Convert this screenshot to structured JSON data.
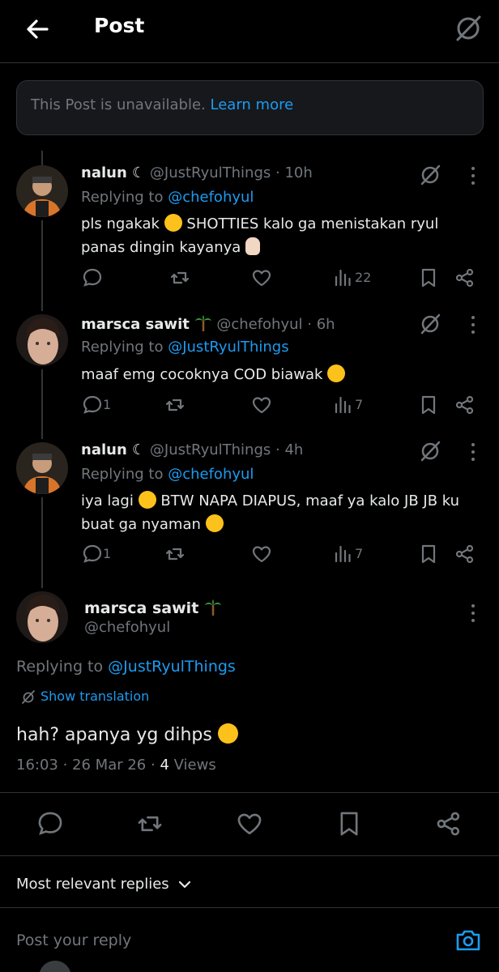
{
  "header": {
    "title": "Post",
    "back_icon": "arrow-left-icon",
    "grok_icon": "grok-icon"
  },
  "unavailable": {
    "text": "This Post is unavailable.",
    "link": "Learn more"
  },
  "replies": [
    {
      "name": "nalun ☾",
      "handle": "@JustRyulThings",
      "time": "· 10h",
      "replying_label": "Replying to",
      "replying_to": "@chefohyul",
      "text_a": "pls ngakak",
      "text_b": "SHOTTIES kalo ga menistakan ryul panas dingin kayanya",
      "replies": "",
      "views": "22"
    },
    {
      "name": "marsca sawit",
      "handle": "@chefohyul",
      "time": "· 6h",
      "replying_label": "Replying to",
      "replying_to": "@JustRyulThings",
      "text_a": "maaf emg cocoknya COD biawak",
      "replies": "1",
      "views": "7"
    },
    {
      "name": "nalun ☾",
      "handle": "@JustRyulThings",
      "time": "· 4h",
      "replying_label": "Replying to",
      "replying_to": "@chefohyul",
      "text_a": "iya lagi",
      "text_b": "BTW NAPA DIAPUS, maaf ya kalo JB JB ku buat ga nyaman",
      "replies": "1",
      "views": "7"
    }
  ],
  "main_post": {
    "name": "marsca sawit",
    "handle": "@chefohyul",
    "replying_label": "Replying to",
    "replying_to": "@JustRyulThings",
    "show_translation": "Show translation",
    "text": "hah? apanya yg dihps",
    "meta_time": "16:03 · 26 Mar 26 ·",
    "meta_views": "4",
    "meta_views_label": "Views"
  },
  "sort": {
    "label": "Most relevant replies"
  },
  "composer": {
    "placeholder": "Post your reply",
    "camera_icon": "camera-icon"
  },
  "colors": {
    "accent": "#1d9bf0",
    "muted": "#71767b",
    "text": "#e7e9ea",
    "background": "#000000"
  }
}
